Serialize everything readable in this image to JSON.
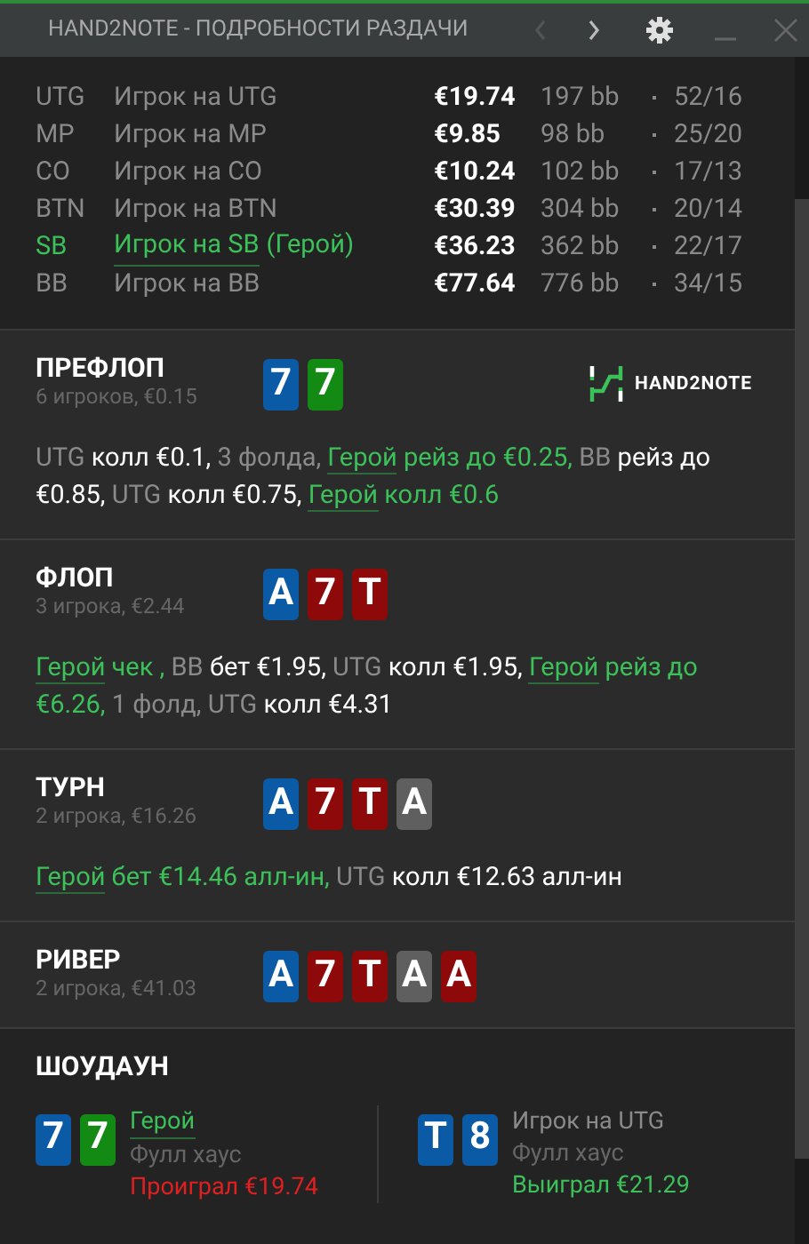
{
  "window": {
    "title": "HAND2NOTE - ПОДРОБНОСТИ РАЗДАЧИ"
  },
  "seats": [
    {
      "position": "UTG",
      "name": "Игрок на UTG",
      "hero": false,
      "stack": "€19.74",
      "bb": "197 bb",
      "stat": "52/16"
    },
    {
      "position": "MP",
      "name": "Игрок на MP",
      "hero": false,
      "stack": "€9.85",
      "bb": "98 bb",
      "stat": "25/20"
    },
    {
      "position": "CO",
      "name": "Игрок на CO",
      "hero": false,
      "stack": "€10.24",
      "bb": "102 bb",
      "stat": "17/13"
    },
    {
      "position": "BTN",
      "name": "Игрок на BTN",
      "hero": false,
      "stack": "€30.39",
      "bb": "304 bb",
      "stat": "20/14"
    },
    {
      "position": "SB",
      "name": "Игрок на SB",
      "tag": "(Герой)",
      "hero": true,
      "stack": "€36.23",
      "bb": "362 bb",
      "stat": "22/17"
    },
    {
      "position": "BB",
      "name": "Игрок на BB",
      "hero": false,
      "stack": "€77.64",
      "bb": "776 bb",
      "stat": "34/15"
    }
  ],
  "logo": {
    "text": "HAND2NOTE"
  },
  "streets": [
    {
      "name": "ПРЕФЛОП",
      "info": "6 игроков, €0.15",
      "cards": [
        {
          "rank": "7",
          "color": "#0b5aa6"
        },
        {
          "rank": "7",
          "color": "#138a13"
        }
      ],
      "actions": [
        {
          "kind": "player",
          "text": "UTG"
        },
        {
          "kind": "action",
          "text": " колл €0.1,"
        },
        {
          "kind": "fold",
          "text": " 3 фолда, "
        },
        {
          "kind": "hero-name",
          "text": "Герой"
        },
        {
          "kind": "hero-action",
          "text": " рейз до €0.25,"
        },
        {
          "kind": "player",
          "text": " BB"
        },
        {
          "kind": "action",
          "text": " рейз до €0.85,"
        },
        {
          "kind": "player",
          "text": " UTG"
        },
        {
          "kind": "action",
          "text": " колл €0.75, "
        },
        {
          "kind": "hero-name",
          "text": "Герой"
        },
        {
          "kind": "hero-action",
          "text": " колл €0.6"
        }
      ]
    },
    {
      "name": "ФЛОП",
      "info": "3 игрока, €2.44",
      "cards": [
        {
          "rank": "A",
          "color": "#0b5aa6"
        },
        {
          "rank": "7",
          "color": "#8e0a0a"
        },
        {
          "rank": "T",
          "color": "#8e0a0a"
        }
      ],
      "actions": [
        {
          "kind": "hero-name",
          "text": "Герой"
        },
        {
          "kind": "hero-action",
          "text": " чек ,"
        },
        {
          "kind": "player",
          "text": " BB"
        },
        {
          "kind": "action",
          "text": " бет €1.95,"
        },
        {
          "kind": "player",
          "text": " UTG"
        },
        {
          "kind": "action",
          "text": " колл €1.95, "
        },
        {
          "kind": "hero-name",
          "text": "Герой"
        },
        {
          "kind": "hero-action",
          "text": " рейз до €6.26,"
        },
        {
          "kind": "fold",
          "text": " 1 фолд,"
        },
        {
          "kind": "player",
          "text": " UTG"
        },
        {
          "kind": "action",
          "text": " колл €4.31"
        }
      ]
    },
    {
      "name": "ТУРН",
      "info": "2 игрока, €16.26",
      "cards": [
        {
          "rank": "A",
          "color": "#0b5aa6"
        },
        {
          "rank": "7",
          "color": "#8e0a0a"
        },
        {
          "rank": "T",
          "color": "#8e0a0a"
        },
        {
          "rank": "A",
          "color": "#5f5f5f"
        }
      ],
      "actions": [
        {
          "kind": "hero-name",
          "text": "Герой"
        },
        {
          "kind": "hero-action",
          "text": " бет €14.46 алл-ин,"
        },
        {
          "kind": "player",
          "text": " UTG"
        },
        {
          "kind": "action",
          "text": " колл €12.63 алл-ин"
        }
      ]
    },
    {
      "name": "РИВЕР",
      "info": "2 игрока, €41.03",
      "cards": [
        {
          "rank": "A",
          "color": "#0b5aa6"
        },
        {
          "rank": "7",
          "color": "#8e0a0a"
        },
        {
          "rank": "T",
          "color": "#8e0a0a"
        },
        {
          "rank": "A",
          "color": "#5f5f5f"
        },
        {
          "rank": "A",
          "color": "#8e0a0a"
        }
      ]
    }
  ],
  "showdown": {
    "title": "ШОУДАУН",
    "players": [
      {
        "name": "Герой",
        "hero": true,
        "hand": "Фулл хаус",
        "result": "Проиграл €19.74",
        "won": false,
        "cards": [
          {
            "rank": "7",
            "color": "#0b5aa6"
          },
          {
            "rank": "7",
            "color": "#138a13"
          }
        ]
      },
      {
        "name": "Игрок на UTG",
        "hero": false,
        "hand": "Фулл хаус",
        "result": "Выиграл €21.29",
        "won": true,
        "cards": [
          {
            "rank": "T",
            "color": "#0b5aa6"
          },
          {
            "rank": "8",
            "color": "#0b5aa6"
          }
        ]
      }
    ]
  }
}
